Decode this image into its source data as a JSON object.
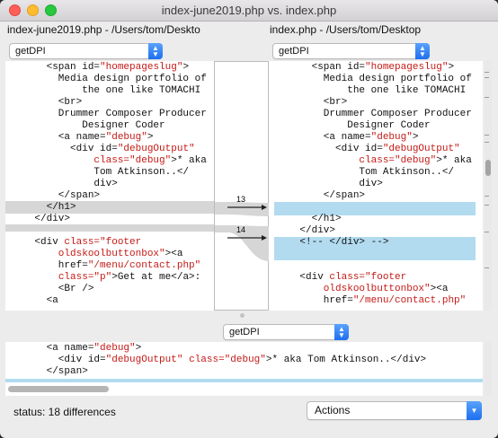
{
  "window": {
    "title": "index-june2019.php vs. index.php"
  },
  "left": {
    "path": "index-june2019.php - /Users/tom/Deskto",
    "func": "getDPI"
  },
  "right": {
    "path": "index.php - /Users/tom/Desktop",
    "func": "getDPI"
  },
  "merge": {
    "func": "getDPI"
  },
  "diff_markers": [
    "13",
    "14"
  ],
  "left_lines": [
    [
      {
        "t": "      <span id=",
        "c": "t"
      },
      {
        "t": "\"homepageslug\"",
        "c": "s"
      },
      {
        "t": ">",
        "c": "t"
      }
    ],
    [
      {
        "t": "        Media design portfolio of",
        "c": "t"
      }
    ],
    [
      {
        "t": "            the one like TOMACHI",
        "c": "t"
      }
    ],
    [
      {
        "t": "        <br>",
        "c": "t"
      }
    ],
    [
      {
        "t": "        Drummer Composer Producer",
        "c": "t"
      }
    ],
    [
      {
        "t": "            Designer Coder",
        "c": "t"
      }
    ],
    [
      {
        "t": "        <a name=",
        "c": "t"
      },
      {
        "t": "\"debug\"",
        "c": "s"
      },
      {
        "t": ">",
        "c": "t"
      }
    ],
    [
      {
        "t": "          <div id=",
        "c": "t"
      },
      {
        "t": "\"debugOutput\"",
        "c": "s"
      }
    ],
    [
      {
        "t": "              ",
        "c": "t"
      },
      {
        "t": "class=",
        "c": "s"
      },
      {
        "t": "\"debug\"",
        "c": "s"
      },
      {
        "t": ">* aka",
        "c": "t"
      }
    ],
    [
      {
        "t": "              Tom Atkinson..</",
        "c": "t"
      }
    ],
    [
      {
        "t": "              div>",
        "c": "t"
      }
    ],
    [
      {
        "t": "        </span>",
        "c": "t"
      }
    ],
    [
      {
        "t": "      </h1>",
        "c": "t"
      }
    ],
    [
      {
        "t": "    </div>",
        "c": "t"
      }
    ],
    [
      {
        "t": "",
        "c": "t"
      }
    ],
    [
      {
        "t": "    <div ",
        "c": "t"
      },
      {
        "t": "class=",
        "c": "s"
      },
      {
        "t": "\"footer",
        "c": "s"
      }
    ],
    [
      {
        "t": "        oldskoolbuttonbox\"",
        "c": "s"
      },
      {
        "t": "><a",
        "c": "t"
      }
    ],
    [
      {
        "t": "        href=",
        "c": "t"
      },
      {
        "t": "\"/menu/contact.php\"",
        "c": "s"
      }
    ],
    [
      {
        "t": "        ",
        "c": "t"
      },
      {
        "t": "class=",
        "c": "s"
      },
      {
        "t": "\"p\"",
        "c": "s"
      },
      {
        "t": ">Get at me</a>:",
        "c": "t"
      }
    ],
    [
      {
        "t": "        <Br />",
        "c": "t"
      }
    ],
    [
      {
        "t": "      <a",
        "c": "t"
      }
    ]
  ],
  "right_lines": [
    [
      {
        "t": "      <span id=",
        "c": "t"
      },
      {
        "t": "\"homepageslug\"",
        "c": "s"
      },
      {
        "t": ">",
        "c": "t"
      }
    ],
    [
      {
        "t": "        Media design portfolio of",
        "c": "t"
      }
    ],
    [
      {
        "t": "            the one like TOMACHI",
        "c": "t"
      }
    ],
    [
      {
        "t": "        <br>",
        "c": "t"
      }
    ],
    [
      {
        "t": "        Drummer Composer Producer",
        "c": "t"
      }
    ],
    [
      {
        "t": "            Designer Coder",
        "c": "t"
      }
    ],
    [
      {
        "t": "        <a name=",
        "c": "t"
      },
      {
        "t": "\"debug\"",
        "c": "s"
      },
      {
        "t": ">",
        "c": "t"
      }
    ],
    [
      {
        "t": "          <div id=",
        "c": "t"
      },
      {
        "t": "\"debugOutput\"",
        "c": "s"
      }
    ],
    [
      {
        "t": "              ",
        "c": "t"
      },
      {
        "t": "class=",
        "c": "s"
      },
      {
        "t": "\"debug\"",
        "c": "s"
      },
      {
        "t": ">* aka",
        "c": "t"
      }
    ],
    [
      {
        "t": "              Tom Atkinson..</",
        "c": "t"
      }
    ],
    [
      {
        "t": "              div>",
        "c": "t"
      }
    ],
    [
      {
        "t": "        </span>",
        "c": "t"
      }
    ],
    [
      {
        "t": "",
        "c": "t"
      }
    ],
    [
      {
        "t": "      </h1>",
        "c": "t"
      }
    ],
    [
      {
        "t": "    </div>",
        "c": "t"
      }
    ],
    [
      {
        "t": "    <!-- </div> -->",
        "c": "t"
      }
    ],
    [
      {
        "t": "",
        "c": "t"
      }
    ],
    [
      {
        "t": "",
        "c": "t"
      }
    ],
    [
      {
        "t": "    <div ",
        "c": "t"
      },
      {
        "t": "class=",
        "c": "s"
      },
      {
        "t": "\"footer",
        "c": "s"
      }
    ],
    [
      {
        "t": "        oldskoolbuttonbox\"",
        "c": "s"
      },
      {
        "t": "><a",
        "c": "t"
      }
    ],
    [
      {
        "t": "        href=",
        "c": "t"
      },
      {
        "t": "\"/menu/contact.php\"",
        "c": "s"
      }
    ]
  ],
  "merge_lines": [
    [
      {
        "t": "      <a name=",
        "c": "t"
      },
      {
        "t": "\"debug\"",
        "c": "s"
      },
      {
        "t": ">",
        "c": "t"
      }
    ],
    [
      {
        "t": "        <div id=",
        "c": "t"
      },
      {
        "t": "\"debugOutput\"",
        "c": "s"
      },
      {
        "t": " ",
        "c": "t"
      },
      {
        "t": "class=",
        "c": "s"
      },
      {
        "t": "\"debug\"",
        "c": "s"
      },
      {
        "t": ">* aka Tom Atkinson..</div>",
        "c": "t"
      }
    ],
    [
      {
        "t": "      </span>",
        "c": "t"
      }
    ]
  ],
  "status": "status: 18 differences",
  "actions": "Actions"
}
